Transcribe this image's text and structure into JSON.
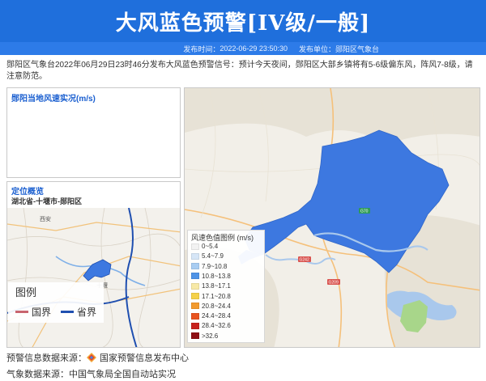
{
  "header": {
    "title": "大风蓝色预警[IV级/一般]",
    "publish_time_label": "发布时间：",
    "publish_time": "2022-06-29 23:50:30",
    "publisher_label": "发布单位：",
    "publisher": "郧阳区气象台"
  },
  "notice": "郧阳区气象台2022年06月29日23时46分发布大风蓝色预警信号：预计今天夜间，郧阳区大部乡镇将有5-6级偏东风，阵风7-8级，请注意防范。",
  "wind_panel": {
    "title": "郧阳当地风速实况(m/s)"
  },
  "location_panel": {
    "title": "定位概览",
    "path": "湖北省-十堰市-郧阳区",
    "map_labels": [
      "西安",
      "十堰"
    ],
    "legend": {
      "title": "图例",
      "items": [
        {
          "label": "国界",
          "color": "#c8646e"
        },
        {
          "label": "省界",
          "color": "#1f4fb0"
        }
      ]
    }
  },
  "main_map": {
    "road_labels": [
      "G70",
      "G242",
      "G209"
    ],
    "warning_color": "#3d78e0",
    "water_color": "#a9c8ec",
    "park_color": "#a8d68a"
  },
  "wind_legend": {
    "title": "风速色值图例 (m/s)",
    "items": [
      {
        "label": "0~5.4",
        "color": "#f2f2f2"
      },
      {
        "label": "5.4~7.9",
        "color": "#d6e6f7"
      },
      {
        "label": "7.9~10.8",
        "color": "#a8cdf2"
      },
      {
        "label": "10.8~13.8",
        "color": "#4f93e6"
      },
      {
        "label": "13.8~17.1",
        "color": "#f7e9a6"
      },
      {
        "label": "17.1~20.8",
        "color": "#f5d14a"
      },
      {
        "label": "20.8~24.4",
        "color": "#f29a2e"
      },
      {
        "label": "24.4~28.4",
        "color": "#e8531f"
      },
      {
        "label": "28.4~32.6",
        "color": "#c7221d"
      },
      {
        "label": ">32.6",
        "color": "#8f0f14"
      }
    ]
  },
  "footer": {
    "source_label": "预警信息数据来源：",
    "source": "国家预警信息发布中心",
    "weather_label": "气象数据来源：",
    "weather_source": "中国气象局全国自动站实况"
  }
}
